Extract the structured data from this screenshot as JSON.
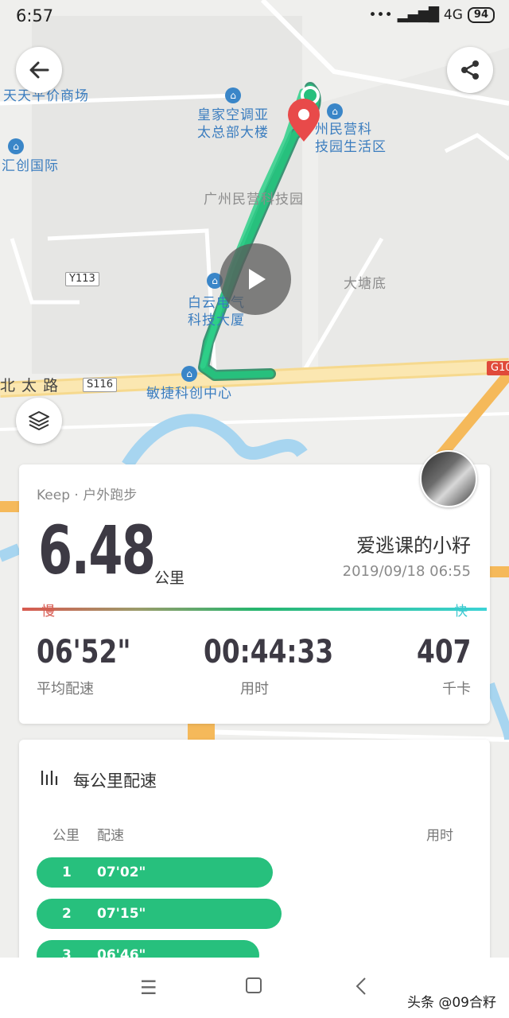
{
  "status_bar": {
    "time": "6:57",
    "network": "4G",
    "battery": "94"
  },
  "map": {
    "labels": {
      "mall": "天天平价商场",
      "building1": "皇家空调亚\n太总部大楼",
      "park_life": "州民营科\n技园生活区",
      "huichuang": "汇创国际",
      "park": "广州民营科技园",
      "road_y113": "Y113",
      "datangdi": "大塘底",
      "baiyun": "白云电气\n科技大厦",
      "beitai_road": "北 太 路",
      "road_s116": "S116",
      "minjie": "敏捷科创中心",
      "road_g10": "G10"
    },
    "route_color": "#1db47c",
    "pin_color": "#e84a4a"
  },
  "summary": {
    "source": "Keep · 户外跑步",
    "distance": "6.48",
    "distance_unit": "公里",
    "user_name": "爱逃课的小籽",
    "datetime": "2019/09/18 06:55",
    "slow_label": "慢",
    "fast_label": "快",
    "stats": [
      {
        "value": "06'52\"",
        "label": "平均配速"
      },
      {
        "value": "00:44:33",
        "label": "用时"
      },
      {
        "value": "407",
        "label": "千卡"
      }
    ]
  },
  "splits": {
    "title": "每公里配速",
    "col_km": "公里",
    "col_pace": "配速",
    "col_time": "用时",
    "rows": [
      {
        "km": "1",
        "pace": "07'02\""
      },
      {
        "km": "2",
        "pace": "07'15\""
      },
      {
        "km": "3",
        "pace": "06'46\""
      }
    ],
    "pace_fraction": [
      0.53,
      0.55,
      0.5
    ]
  },
  "watermark": "头条 @09合籽"
}
